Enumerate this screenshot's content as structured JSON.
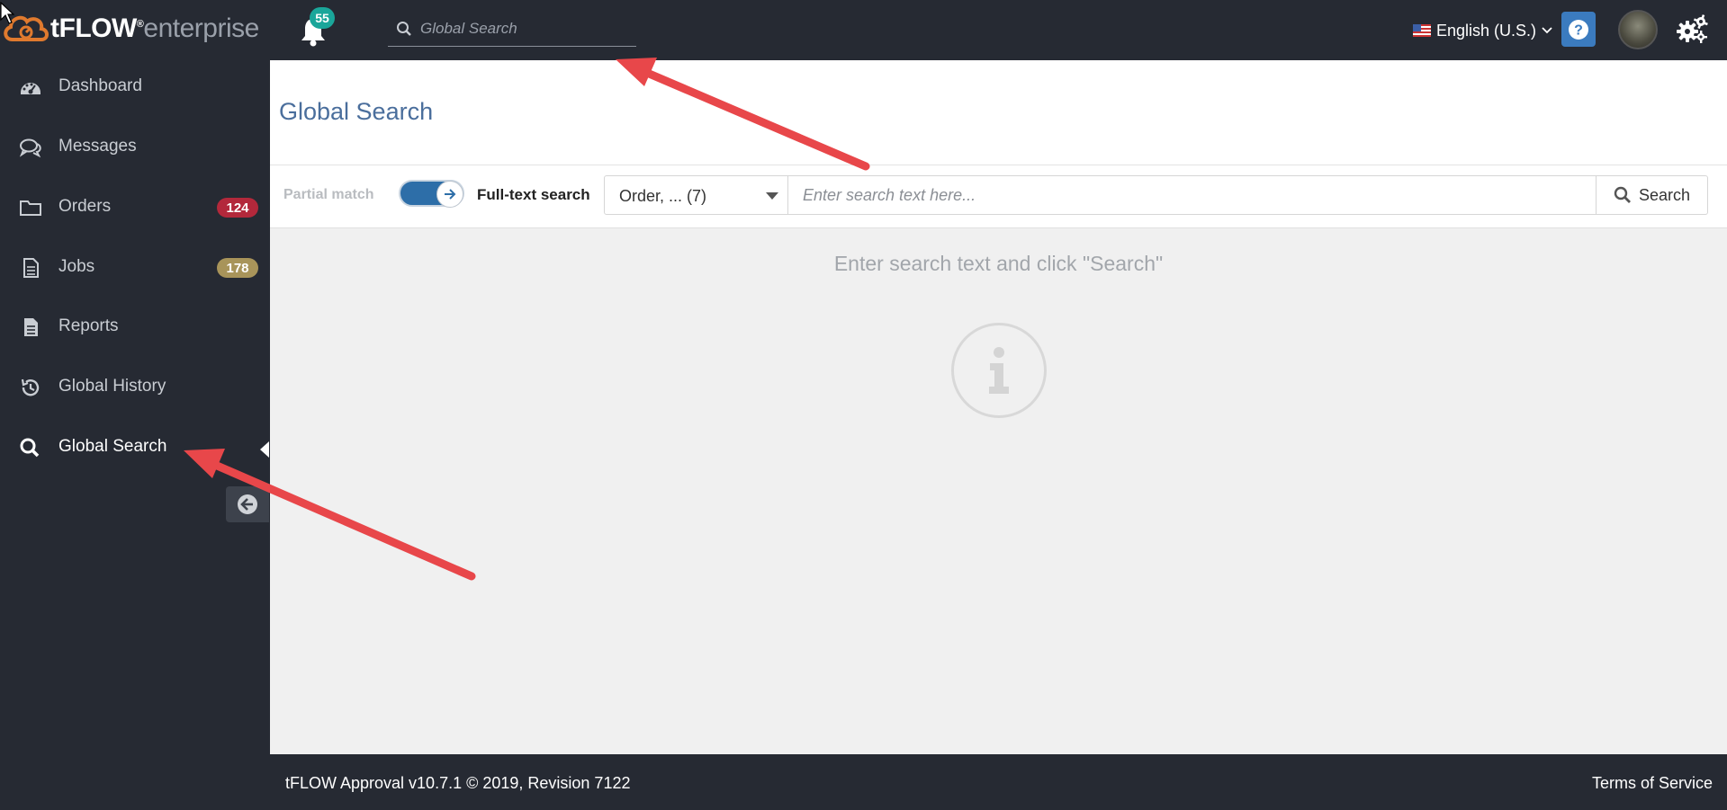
{
  "app": {
    "logo_main": "tFLOW",
    "logo_reg": "®",
    "logo_suffix": "enterprise"
  },
  "topbar": {
    "notifications_count": "55",
    "search_placeholder": "Global Search",
    "language": "English (U.S.)",
    "help_label": "?"
  },
  "sidebar": {
    "items": [
      {
        "label": "Dashboard",
        "icon": "dashboard-icon"
      },
      {
        "label": "Messages",
        "icon": "messages-icon"
      },
      {
        "label": "Orders",
        "icon": "folder-icon",
        "badge": "124"
      },
      {
        "label": "Jobs",
        "icon": "document-icon",
        "badge": "178"
      },
      {
        "label": "Reports",
        "icon": "report-icon"
      },
      {
        "label": "Global History",
        "icon": "history-icon"
      },
      {
        "label": "Global Search",
        "icon": "search-icon",
        "active": true
      }
    ]
  },
  "main": {
    "page_title": "Global Search",
    "partial_match_label": "Partial match",
    "fulltext_label": "Full-text search",
    "scope_select_value": "Order, ... (7)",
    "search_placeholder": "Enter search text here...",
    "search_button_label": "Search",
    "empty_message": "Enter search text and click \"Search\""
  },
  "footer": {
    "version": "tFLOW Approval v10.7.1 © 2019, Revision 7122",
    "terms": "Terms of Service"
  },
  "colors": {
    "dark_bg": "#262a33",
    "accent_blue": "#3b7bbf",
    "orders_badge": "#b3283b",
    "jobs_badge": "#a8945a",
    "notif_badge": "#1aa69a",
    "logo_orange": "#e07a2e",
    "annotation_red": "#e8474a"
  }
}
